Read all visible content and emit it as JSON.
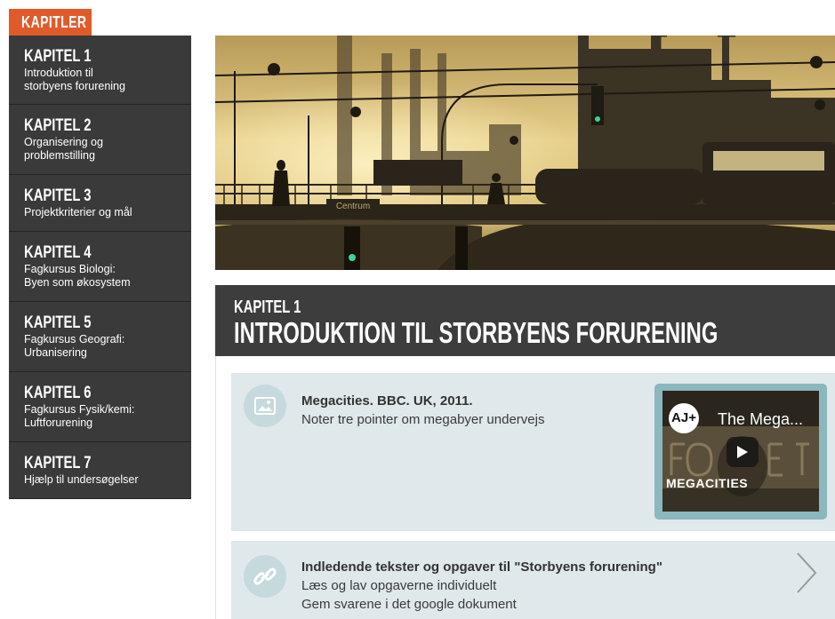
{
  "sidebar": {
    "tab_label": "KAPITLER",
    "items": [
      {
        "chapter": "KAPITEL 1",
        "sub1": "Introduktion til",
        "sub2": "storbyens forurening"
      },
      {
        "chapter": "KAPITEL 2",
        "sub1": "Organisering og",
        "sub2": "problemstilling"
      },
      {
        "chapter": "KAPITEL 3",
        "sub1": "Projektkriterier og mål",
        "sub2": ""
      },
      {
        "chapter": "KAPITEL 4",
        "sub1": "Fagkursus Biologi:",
        "sub2": "Byen som økosystem"
      },
      {
        "chapter": "KAPITEL 5",
        "sub1": "Fagkursus Geografi:",
        "sub2": "Urbanisering"
      },
      {
        "chapter": "KAPITEL 6",
        "sub1": "Fagkursus Fysik/kemi:",
        "sub2": "Luftforurening"
      },
      {
        "chapter": "KAPITEL 7",
        "sub1": "Hjælp til undersøgelser",
        "sub2": ""
      }
    ]
  },
  "hero": {
    "sign_text": "Centrum"
  },
  "header": {
    "label": "KAPITEL 1",
    "title": "INTRODUKTION TIL STORBYENS FORURENING"
  },
  "cards": [
    {
      "icon": "image-icon",
      "title": "Megacities. BBC. UK, 2011.",
      "line1": "Noter tre pointer om megabyer undervejs",
      "line2": "",
      "video": {
        "logo": "AJ+",
        "title": "The Mega...",
        "caption": "MEGACITIES",
        "icon": "play-icon"
      }
    },
    {
      "icon": "link-icon",
      "title": "Indledende tekster og opgaver til \"Storbyens forurening\"",
      "line1": "Læs og lav opgaverne individuelt",
      "line2": "Gem svarene i det google dokument",
      "arrow_icon": "chevron-right-icon"
    }
  ],
  "colors": {
    "accent": "#e05a2b",
    "sidebar_bg": "#3a3a3a",
    "card_bg": "#dfe8eb",
    "icon_circle": "#c6d9dd",
    "video_frame": "#8ab8bc"
  }
}
